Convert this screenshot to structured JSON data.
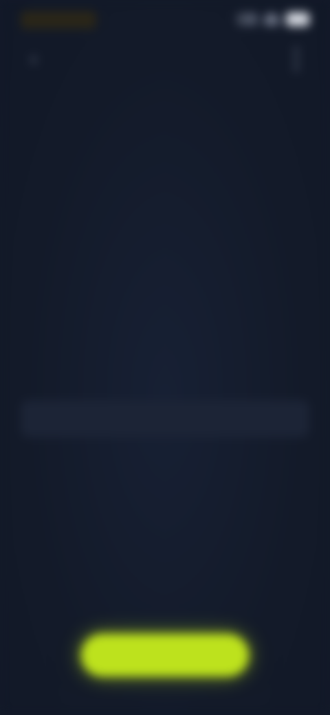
{
  "status_bar": {
    "time": "",
    "icons": [
      "signal-icon",
      "wifi-icon",
      "battery-icon"
    ]
  },
  "header": {
    "title": "",
    "back_icon": "chevron-left-icon",
    "menu_icon": "more-vertical-icon"
  },
  "info": {
    "label": "",
    "headline": "",
    "card_text": ""
  },
  "primary_button": {
    "label": "",
    "color": "#bde21d"
  },
  "colors": {
    "background": "#131a29",
    "card": "#1c2436",
    "accent": "#bde21d"
  }
}
